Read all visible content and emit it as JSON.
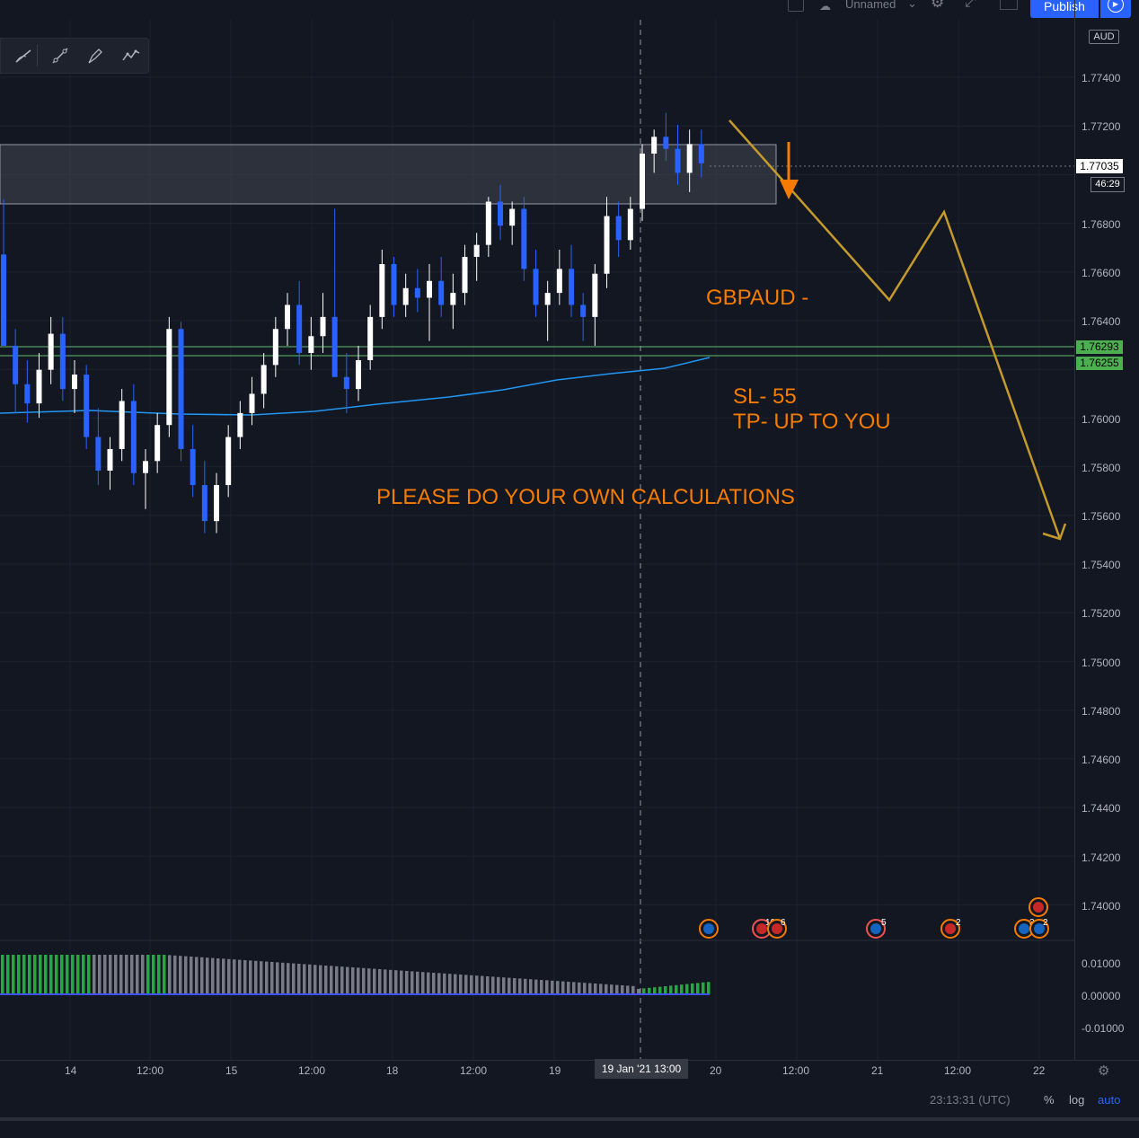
{
  "topbar": {
    "layout_name": "Unnamed",
    "publish_label": "Publish",
    "icons": [
      "square-icon",
      "cloud-icon",
      "chevron-down-icon",
      "gear-icon",
      "fullscreen-icon",
      "camera-icon",
      "play-icon"
    ]
  },
  "drawing_toolbar": {
    "tools": [
      "trend-line-icon",
      "ray-icon",
      "brush-icon",
      "path-icon"
    ]
  },
  "price_axis": {
    "currency": "AUD",
    "ticks": [
      "1.77400",
      "1.77200",
      "1.76800",
      "1.76600",
      "1.76400",
      "1.76000",
      "1.75800",
      "1.75600",
      "1.75400",
      "1.75200",
      "1.75000",
      "1.74800",
      "1.74600",
      "1.74400",
      "1.74200",
      "1.74000"
    ],
    "current_price": "1.77035",
    "countdown": "46:29",
    "green_levels": [
      "1.76293",
      "1.76255"
    ]
  },
  "macd_axis": {
    "ticks": [
      "0.01000",
      "0.00000",
      "-0.01000"
    ]
  },
  "time_axis": {
    "ticks": [
      "14",
      "12:00",
      "15",
      "12:00",
      "18",
      "12:00",
      "19",
      "20",
      "12:00",
      "21",
      "12:00",
      "22"
    ],
    "crosshair_label": "19 Jan '21   13:00"
  },
  "annotations": {
    "pair": "GBPAUD -",
    "sl": "SL- 55",
    "tp": "TP- UP TO YOU",
    "disclaimer": "PLEASE DO YOUR OWN CALCULATIONS"
  },
  "events": {
    "counts": [
      "10",
      "6",
      "5",
      "2",
      "3",
      "2"
    ]
  },
  "status_bar": {
    "clock": "23:13:31 (UTC)",
    "percent": "%",
    "log": "log",
    "auto": "auto"
  },
  "colors": {
    "background": "#131722",
    "up_candle": "#ffffff",
    "down_candle": "#2962ff",
    "accent": "#2962ff",
    "annotation": "#f57c00",
    "path": "#c49a2c",
    "ma": "#2196f3",
    "level": "#4caf50"
  },
  "chart_data": {
    "type": "candlestick",
    "ylim": [
      1.7395,
      1.776
    ],
    "pair": "GBPAUD",
    "current_price": 1.77035,
    "resistance_zone": [
      1.7689,
      1.7713
    ],
    "green_levels": [
      1.76293,
      1.76255
    ],
    "forecast_path": [
      1.772,
      1.7665,
      1.7685,
      1.755
    ],
    "candles": [
      [
        1.7666,
        1.7689,
        1.7655,
        1.7628
      ],
      [
        1.7628,
        1.7635,
        1.76,
        1.7612
      ],
      [
        1.7612,
        1.7622,
        1.7596,
        1.7604
      ],
      [
        1.7604,
        1.7625,
        1.7598,
        1.7618
      ],
      [
        1.7618,
        1.764,
        1.7612,
        1.7633
      ],
      [
        1.7633,
        1.764,
        1.7605,
        1.761
      ],
      [
        1.761,
        1.7622,
        1.76,
        1.7616
      ],
      [
        1.7616,
        1.762,
        1.7585,
        1.759
      ],
      [
        1.759,
        1.7602,
        1.757,
        1.7576
      ],
      [
        1.7576,
        1.759,
        1.7568,
        1.7585
      ],
      [
        1.7585,
        1.761,
        1.758,
        1.7605
      ],
      [
        1.7605,
        1.7612,
        1.757,
        1.7575
      ],
      [
        1.7575,
        1.7585,
        1.756,
        1.758
      ],
      [
        1.758,
        1.76,
        1.7575,
        1.7595
      ],
      [
        1.7595,
        1.764,
        1.759,
        1.7635
      ],
      [
        1.7635,
        1.7638,
        1.758,
        1.7585
      ],
      [
        1.7585,
        1.7595,
        1.7565,
        1.757
      ],
      [
        1.757,
        1.758,
        1.755,
        1.7555
      ],
      [
        1.7555,
        1.7575,
        1.755,
        1.757
      ],
      [
        1.757,
        1.7595,
        1.7565,
        1.759
      ],
      [
        1.759,
        1.7605,
        1.7585,
        1.76
      ],
      [
        1.76,
        1.7615,
        1.7595,
        1.7608
      ],
      [
        1.7608,
        1.7625,
        1.7602,
        1.762
      ],
      [
        1.762,
        1.764,
        1.7615,
        1.7635
      ],
      [
        1.7635,
        1.765,
        1.7628,
        1.7645
      ],
      [
        1.7645,
        1.7655,
        1.762,
        1.7625
      ],
      [
        1.7625,
        1.764,
        1.7618,
        1.7632
      ],
      [
        1.7632,
        1.765,
        1.7625,
        1.764
      ],
      [
        1.764,
        1.7685,
        1.7635,
        1.7615
      ],
      [
        1.7615,
        1.7625,
        1.76,
        1.761
      ],
      [
        1.761,
        1.7628,
        1.7605,
        1.7622
      ],
      [
        1.7622,
        1.7645,
        1.7618,
        1.764
      ],
      [
        1.764,
        1.7668,
        1.7635,
        1.7662
      ],
      [
        1.7662,
        1.7665,
        1.764,
        1.7645
      ],
      [
        1.7645,
        1.7658,
        1.764,
        1.7652
      ],
      [
        1.7652,
        1.766,
        1.7642,
        1.7648
      ],
      [
        1.7648,
        1.7662,
        1.763,
        1.7655
      ],
      [
        1.7655,
        1.7665,
        1.764,
        1.7645
      ],
      [
        1.7645,
        1.7658,
        1.7635,
        1.765
      ],
      [
        1.765,
        1.767,
        1.7645,
        1.7665
      ],
      [
        1.7665,
        1.7675,
        1.7655,
        1.767
      ],
      [
        1.767,
        1.769,
        1.7665,
        1.7688
      ],
      [
        1.7688,
        1.7695,
        1.7672,
        1.7678
      ],
      [
        1.7678,
        1.7688,
        1.767,
        1.7685
      ],
      [
        1.7685,
        1.769,
        1.7655,
        1.766
      ],
      [
        1.766,
        1.7668,
        1.764,
        1.7645
      ],
      [
        1.7645,
        1.7655,
        1.763,
        1.765
      ],
      [
        1.765,
        1.7668,
        1.7645,
        1.766
      ],
      [
        1.766,
        1.767,
        1.764,
        1.7645
      ],
      [
        1.7645,
        1.765,
        1.763,
        1.764
      ],
      [
        1.764,
        1.7662,
        1.7628,
        1.7658
      ],
      [
        1.7658,
        1.769,
        1.7652,
        1.7682
      ],
      [
        1.7682,
        1.7688,
        1.7665,
        1.7672
      ],
      [
        1.7672,
        1.769,
        1.7668,
        1.7685
      ],
      [
        1.7685,
        1.7712,
        1.768,
        1.7708
      ],
      [
        1.7708,
        1.7718,
        1.77,
        1.7715
      ],
      [
        1.7715,
        1.7725,
        1.7705,
        1.771
      ],
      [
        1.771,
        1.772,
        1.7695,
        1.77
      ],
      [
        1.77,
        1.7718,
        1.7692,
        1.7712
      ],
      [
        1.7712,
        1.7718,
        1.7698,
        1.7704
      ]
    ]
  }
}
